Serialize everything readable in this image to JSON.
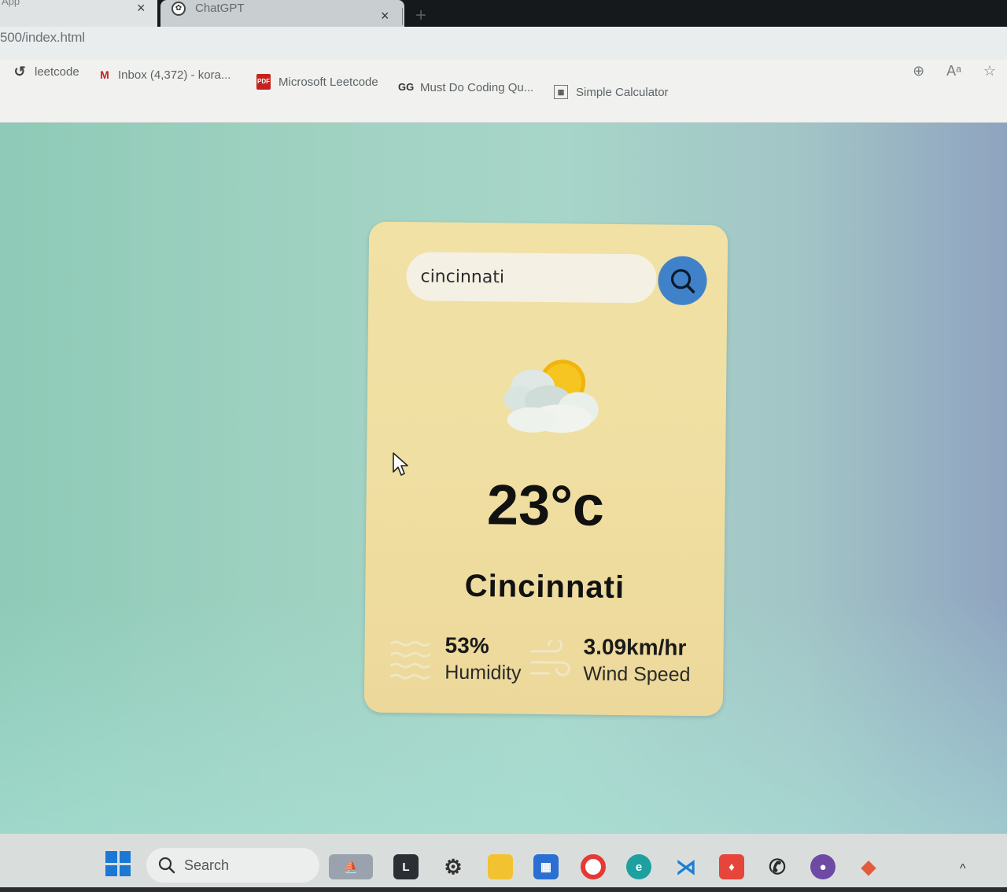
{
  "browser": {
    "tabs": [
      {
        "title": "App",
        "close": "×"
      },
      {
        "title": "ChatGPT",
        "close": "×"
      }
    ],
    "new_tab": "+",
    "url": "500/index.html",
    "bookmarks": [
      {
        "label": "leetcode",
        "icon": "leetcode-icon"
      },
      {
        "label": "Inbox (4,372) - kora...",
        "icon": "gmail-icon"
      },
      {
        "label": "Microsoft Leetcode",
        "icon": "pdf-icon"
      },
      {
        "label": "Must Do Coding Qu...",
        "icon": "gfg-icon"
      },
      {
        "label": "Simple Calculator",
        "icon": "calculator-icon"
      }
    ]
  },
  "weather": {
    "search_value": "cincinnati",
    "search_button_icon": "search-icon",
    "condition_icon": "partly-cloudy-icon",
    "temperature": "23°c",
    "city": "Cincinnati",
    "humidity": {
      "value": "53%",
      "label": "Humidity",
      "icon": "humidity-icon"
    },
    "wind": {
      "value": "3.09km/hr",
      "label": "Wind Speed",
      "icon": "wind-icon"
    },
    "colors": {
      "card": "#f0dfa2",
      "button": "#3f82c9"
    }
  },
  "taskbar": {
    "search_label": "Search",
    "apps": [
      "file-explorer",
      "settings",
      "folder",
      "store",
      "chrome",
      "edge",
      "vscode",
      "brave",
      "whatsapp",
      "github",
      "git"
    ],
    "tray_chevron": "^"
  }
}
